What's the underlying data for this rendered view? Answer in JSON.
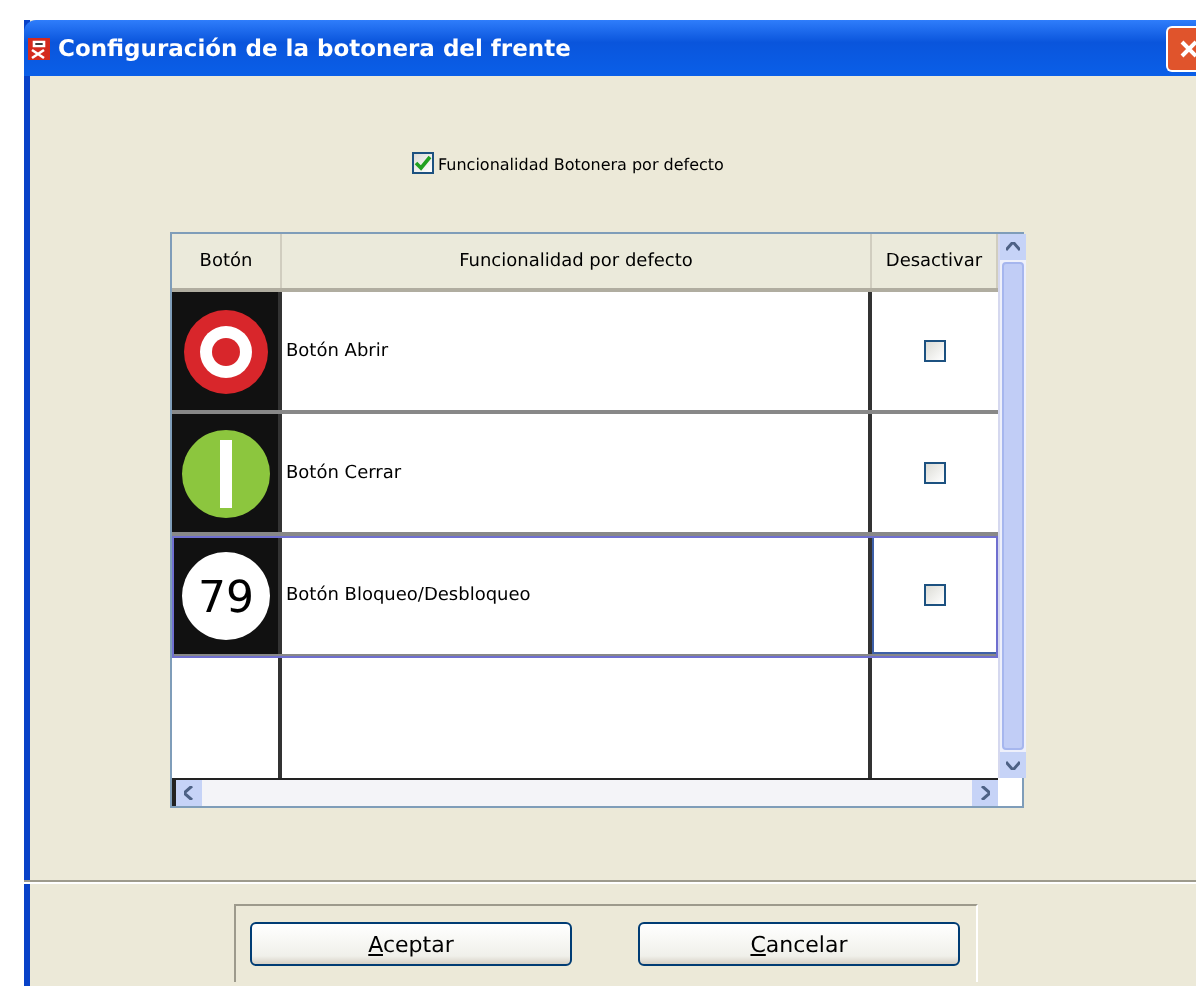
{
  "window": {
    "title": "Configuración de la botonera del frente"
  },
  "default_option": {
    "label": "Funcionalidad Botonera por defecto",
    "checked": true
  },
  "table": {
    "columns": [
      "Botón",
      "Funcionalidad por defecto",
      "Desactivar"
    ],
    "rows": [
      {
        "kind": "ring",
        "function": "Botón Abrir",
        "disabled": false,
        "selected": false
      },
      {
        "kind": "bar",
        "function": "Botón Cerrar",
        "disabled": false,
        "selected": false
      },
      {
        "kind": "number",
        "badge": "79",
        "function": "Botón Bloqueo/Desbloqueo",
        "disabled": false,
        "selected": true
      }
    ]
  },
  "buttons": [
    "Aceptar",
    "Cancelar"
  ]
}
